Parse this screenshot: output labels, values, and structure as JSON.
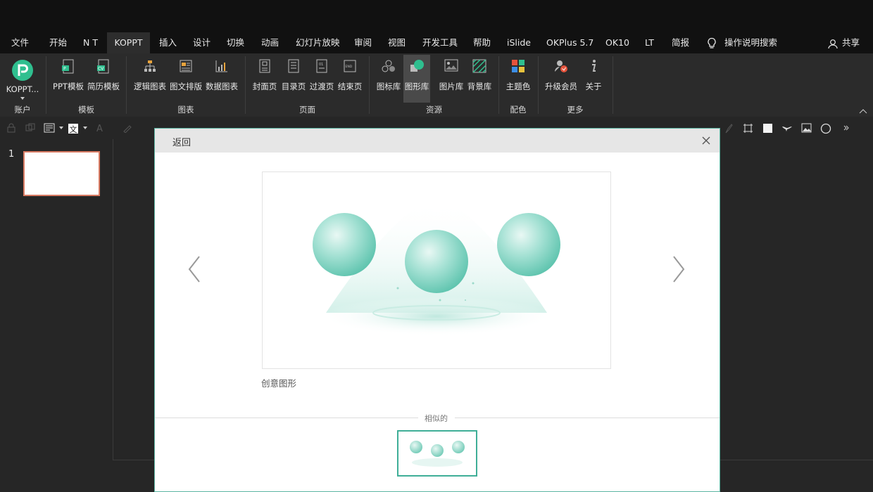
{
  "tabs": [
    "文件",
    "开始",
    "N T",
    "KOPPT",
    "插入",
    "设计",
    "切换",
    "动画",
    "幻灯片放映",
    "审阅",
    "视图",
    "开发工具",
    "帮助",
    "iSlide",
    "OKPlus 5.7",
    "OK10",
    "LT",
    "简报"
  ],
  "active_tab": "KOPPT",
  "tell_me": "操作说明搜索",
  "share": "共享",
  "ribbon": {
    "account": {
      "btn": "KOPPT...",
      "group": "账户"
    },
    "template": {
      "buttons": [
        "PPT模板",
        "简历模板"
      ],
      "group": "模板"
    },
    "chart": {
      "buttons": [
        "逻辑图表",
        "图文排版",
        "数据图表"
      ],
      "group": "图表"
    },
    "page": {
      "buttons": [
        "封面页",
        "目录页",
        "过渡页",
        "结束页"
      ],
      "group": "页面"
    },
    "resource": {
      "buttons": [
        "图标库",
        "图形库",
        "图片库",
        "背景库"
      ],
      "group": "资源"
    },
    "color": {
      "buttons": [
        "主题色"
      ],
      "group": "配色"
    },
    "more": {
      "buttons": [
        "升级会员",
        "关于"
      ],
      "group": "更多"
    }
  },
  "slide": {
    "number": "1"
  },
  "dialog": {
    "back": "返回",
    "caption": "创意图形",
    "similar": "相似的"
  },
  "colors": {
    "accent": "#3fae97",
    "sphere": "#8fd8c9",
    "thumb_border": "#d97b63"
  }
}
